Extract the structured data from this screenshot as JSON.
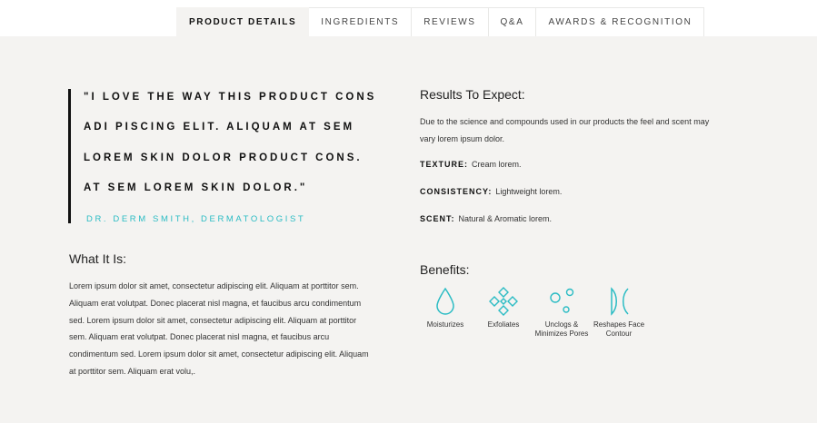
{
  "tabs": [
    {
      "label": "PRODUCT DETAILS",
      "active": true
    },
    {
      "label": "INGREDIENTS",
      "active": false
    },
    {
      "label": "REVIEWS",
      "active": false
    },
    {
      "label": "Q&A",
      "active": false
    },
    {
      "label": "AWARDS & RECOGNITION",
      "active": false
    }
  ],
  "quote": {
    "lines": [
      "\"I LOVE THE WAY THIS PRODUCT CONS",
      "ADI PISCING ELIT. ALIQUAM AT SEM",
      "LOREM SKIN DOLOR PRODUCT CONS.",
      "AT SEM LOREM SKIN DOLOR.\""
    ],
    "author": "DR. DERM SMITH, DERMATOLOGIST"
  },
  "what_it_is": {
    "title": "What It Is:",
    "body": "Lorem ipsum dolor sit amet, consectetur adipiscing elit. Aliquam at porttitor sem.  Aliquam erat volutpat. Donec placerat nisl magna, et faucibus arcu condimentum sed. Lorem ipsum dolor sit amet, consectetur adipiscing elit. Aliquam at porttitor sem.  Aliquam erat volutpat. Donec placerat nisl magna, et faucibus arcu condimentum sed. Lorem ipsum dolor sit amet, consectetur adipiscing elit. Aliquam at porttitor sem.  Aliquam erat volu,."
  },
  "results": {
    "title": "Results To Expect:",
    "intro": "Due to the science and compounds used in our products the feel and scent may vary lorem ipsum dolor.",
    "texture_label": "TEXTURE:",
    "texture_value": "Cream lorem.",
    "consistency_label": "CONSISTENCY:",
    "consistency_value": "Lightweight lorem.",
    "scent_label": "SCENT:",
    "scent_value": "Natural & Aromatic lorem."
  },
  "benefits": {
    "title": "Benefits:",
    "accent_color": "#2bbcc4",
    "items": [
      {
        "label": "Moisturizes",
        "icon": "droplet-icon"
      },
      {
        "label": "Exfoliates",
        "icon": "diamonds-icon"
      },
      {
        "label": "Unclogs & Minimizes Pores",
        "icon": "bubbles-icon"
      },
      {
        "label": "Reshapes Face Contour",
        "icon": "contour-icon"
      }
    ]
  }
}
